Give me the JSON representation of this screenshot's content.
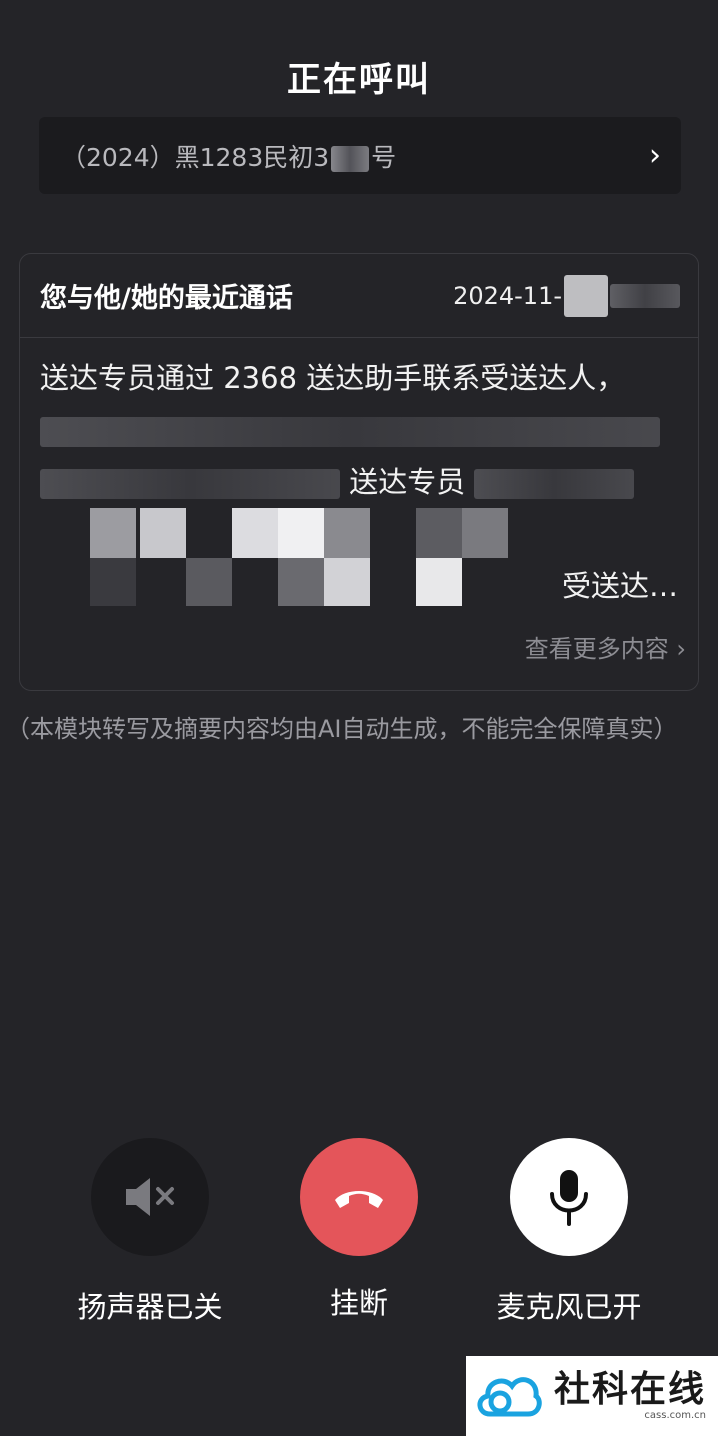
{
  "header": {
    "title": "正在呼叫"
  },
  "case": {
    "number": "（2024）黑1283民初3",
    "suffix": "号"
  },
  "recent_call": {
    "heading": "您与他/她的最近通话",
    "date": "2024-11-",
    "line1": "送达专员通过 2368 送达助手联系受送达人，",
    "line3_visible": "送达专员",
    "line5_visible": "受送达…",
    "more_label": "查看更多内容"
  },
  "disclaimer": "（本模块转写及摘要内容均由AI自动生成，不能完全保障真实）",
  "controls": {
    "speaker_label": "扬声器已关",
    "hangup_label": "挂断",
    "mic_label": "麦克风已开"
  },
  "watermark": {
    "name": "社科在线",
    "domain": "cass.com.cn"
  },
  "colors": {
    "background": "#242428",
    "hangup": "#e4555a",
    "speaker_bg": "#1a1a1d",
    "mic_bg": "#ffffff"
  }
}
